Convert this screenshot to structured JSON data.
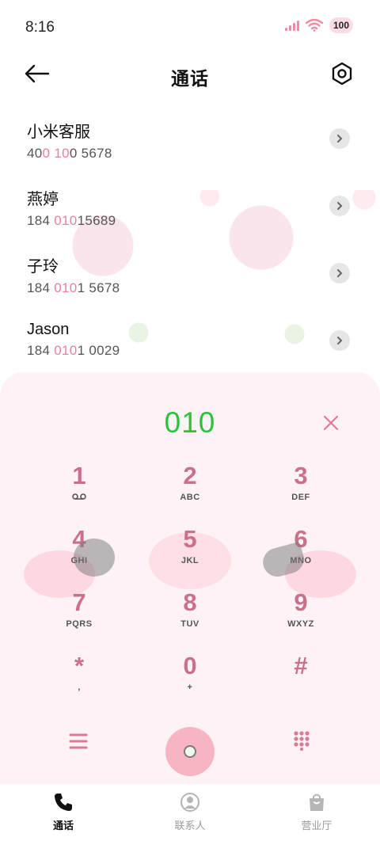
{
  "status_bar": {
    "time": "8:16",
    "battery": "100"
  },
  "header": {
    "title": "通话"
  },
  "contacts": [
    {
      "name": "小米客服",
      "num_pre": "40",
      "num_hl1": "0",
      "num_mid": " ",
      "num_hl2": "10",
      "num_post": "0 5678"
    },
    {
      "name": "燕婷",
      "num_pre": "184 ",
      "num_hl1": "010",
      "num_mid": "",
      "num_hl2": "",
      "num_post": "15689"
    },
    {
      "name": "子玲",
      "num_pre": "184 ",
      "num_hl1": "010",
      "num_mid": "",
      "num_hl2": "",
      "num_post": "1 5678"
    },
    {
      "name": "Jason",
      "num_pre": "184 ",
      "num_hl1": "010",
      "num_mid": "",
      "num_hl2": "",
      "num_post": "1 0029"
    }
  ],
  "dialer": {
    "display": "010"
  },
  "keypad": [
    [
      {
        "digit": "1",
        "letters": "voicemail"
      },
      {
        "digit": "2",
        "letters": "ABC"
      },
      {
        "digit": "3",
        "letters": "DEF"
      }
    ],
    [
      {
        "digit": "4",
        "letters": "GHI"
      },
      {
        "digit": "5",
        "letters": "JKL"
      },
      {
        "digit": "6",
        "letters": "MNO"
      }
    ],
    [
      {
        "digit": "7",
        "letters": "PQRS"
      },
      {
        "digit": "8",
        "letters": "TUV"
      },
      {
        "digit": "9",
        "letters": "WXYZ"
      }
    ],
    [
      {
        "digit": "*",
        "letters": ","
      },
      {
        "digit": "0",
        "letters": "+"
      },
      {
        "digit": "#",
        "letters": ""
      }
    ]
  ],
  "tabs": [
    {
      "label": "通话",
      "icon": "phone-icon",
      "active": true
    },
    {
      "label": "联系人",
      "icon": "person-icon",
      "active": false
    },
    {
      "label": "营业厅",
      "icon": "shopping-bag-icon",
      "active": false
    }
  ],
  "colors": {
    "accent": "#2bc33c",
    "highlight": "#ec7f9b",
    "key": "#c9708a"
  }
}
